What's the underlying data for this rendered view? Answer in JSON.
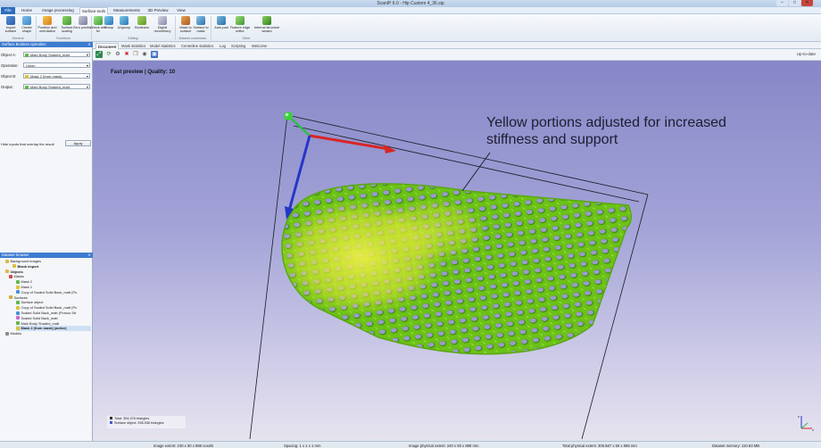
{
  "window": {
    "title": "ScanIP 6.0 - Hip Custom 4_36.sip",
    "buttons": {
      "min": "–",
      "max": "□",
      "close": "✕"
    }
  },
  "ribbon_tabs": [
    "File",
    "Home",
    "Image processing",
    "Surface tools",
    "Measurements",
    "3D Preview",
    "View"
  ],
  "ribbon": {
    "buttons": [
      {
        "label": "Import surface",
        "icon": "import-surface-icon"
      },
      {
        "label": "Create shape",
        "icon": "create-shape-icon"
      },
      {
        "label": "Position and orientation",
        "icon": "position-icon"
      },
      {
        "label": "Surface scaling",
        "icon": "surface-scaling-icon"
      },
      {
        "label": "Zero position",
        "icon": "zero-position-icon"
      },
      {
        "label": "Check and fix",
        "icon": "check-fix-icon"
      },
      {
        "label": "Group",
        "icon": "group-icon"
      },
      {
        "label": "Ungroup",
        "icon": "ungroup-icon"
      },
      {
        "label": "Booleans",
        "icon": "booleans-icon"
      },
      {
        "label": "Digital reconfinery",
        "icon": "reconfinery-icon"
      },
      {
        "label": "Mask to surface",
        "icon": "mask-to-surface-icon"
      },
      {
        "label": "Surface to mask",
        "icon": "surface-to-mask-icon"
      },
      {
        "label": "Auto-pad",
        "icon": "auto-pad-icon"
      },
      {
        "label": "Feature edge editor",
        "icon": "feature-edge-icon"
      },
      {
        "label": "Internal structure wizard",
        "icon": "internal-structure-icon"
      }
    ],
    "groups": [
      "General",
      "Functions",
      "Editing",
      "Dataset conversion",
      "Other"
    ]
  },
  "operation_panel": {
    "title": "Surface Boolean operation",
    "rows": [
      {
        "label": "Object A:",
        "value": "Main Body Shaded_matt"
      },
      {
        "label": "Operation:",
        "value": "Union"
      },
      {
        "label": "Object B:",
        "value": "Mask 2 (from mask)"
      },
      {
        "label": "Output:",
        "value": "Main Body Shaded_matt"
      }
    ],
    "overlap_label": "Hide inputs that overlap the result",
    "apply_label": "Apply"
  },
  "dataset_panel": {
    "title": "Dataset browser",
    "tree": [
      {
        "label": "Background images",
        "indent": 1,
        "icon": "folder-icon"
      },
      {
        "label": "Blank import",
        "indent": 3,
        "bold": true
      },
      {
        "label": "Objects",
        "indent": 1,
        "icon": "folder-icon",
        "bold": true
      },
      {
        "label": "Masks",
        "indent": 2,
        "icon": "mask-icon"
      },
      {
        "label": "Mask 2",
        "indent": 4
      },
      {
        "label": "Mask 1",
        "indent": 4
      },
      {
        "label": "Copy of Scaled Solid Back_matt (Po",
        "indent": 4
      },
      {
        "label": "Surfaces",
        "indent": 2,
        "icon": "surface-icon"
      },
      {
        "label": "Surface object",
        "indent": 4
      },
      {
        "label": "Copy of Scaled Solid Back_matt (Po",
        "indent": 4
      },
      {
        "label": "Scaled Solid Back_matt (Porous Str",
        "indent": 4
      },
      {
        "label": "Scaled Solid Back_matt",
        "indent": 4
      },
      {
        "label": "Main Body Shaded_matt",
        "indent": 4
      },
      {
        "label": "Mask 2 (from mask) (active)",
        "indent": 4,
        "bold": true,
        "selected": true
      },
      {
        "label": "Models",
        "indent": 1,
        "icon": "models-icon"
      }
    ]
  },
  "doc_tabs": [
    "Document",
    "Mask statistics",
    "Model statistics",
    "Centreline statistics",
    "Log",
    "Scripting",
    "Welcome"
  ],
  "viewport": {
    "preview_label": "Fast preview | Quality: 10",
    "status_right": "Up-to-date",
    "annotation": "Yellow portions adjusted for increased stiffness and support",
    "stats": [
      {
        "text": "Total: 354,376 triangles",
        "color": "#333333"
      },
      {
        "text": "Surface object: 256,936 triangles",
        "color": "#3b5bdb"
      }
    ],
    "colors": {
      "lattice_green": "#7fd11b",
      "lattice_yellow": "#e3e832",
      "axis_x": "#d92525",
      "axis_y": "#2436c9",
      "axis_origin": "#3ccf3c"
    }
  },
  "statusbar": [
    "Image extent: 240 x 50 x 888 voxels",
    "Spacing: 1 x 1 x 1 mm",
    "Image physical extent: 240 x 50 x 888 mm",
    "Total physical extent: 305.587 x 50 x 888 mm",
    "Dataset memory: 110.63 MB"
  ]
}
